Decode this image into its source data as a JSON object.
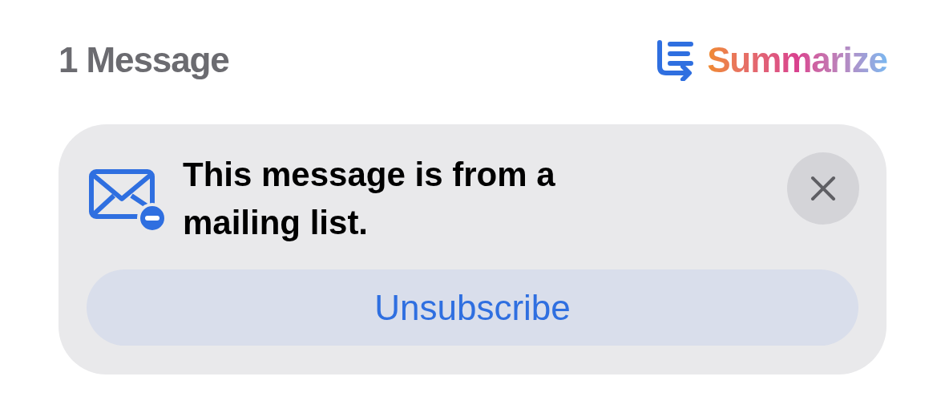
{
  "header": {
    "count": "1 Message",
    "summarize": "Summarize"
  },
  "banner": {
    "message": "This message is from a mailing list.",
    "action": "Unsubscribe"
  }
}
